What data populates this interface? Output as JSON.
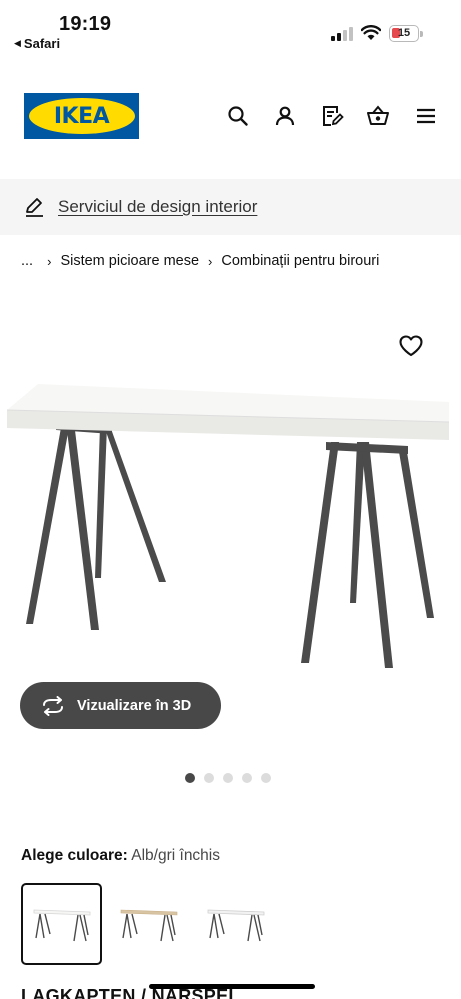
{
  "status_bar": {
    "time": "19:19",
    "back_label": "Safari",
    "battery": "15"
  },
  "header": {
    "logo_text": "IKEA",
    "icons": [
      "search-icon",
      "account-icon",
      "shopping-list-icon",
      "basket-icon",
      "menu-icon"
    ]
  },
  "design_banner": {
    "label": "Serviciul de design interior",
    "icon": "pencil-icon"
  },
  "breadcrumb": {
    "items": [
      "...",
      "Sistem picioare mese",
      "Combinații pentru birouri"
    ],
    "separator": "›"
  },
  "gallery": {
    "view_3d_label": "Vizualizare în 3D",
    "dot_count": 5,
    "active_dot": 1
  },
  "color_select": {
    "label": "Alege culoare:",
    "value": "Alb/gri închis",
    "options": [
      {
        "name": "white-dark-grey",
        "top_color": "#f6f6f4",
        "leg_color": "#4a4a4a",
        "selected": true
      },
      {
        "name": "birch-dark-grey",
        "top_color": "#d8c4a2",
        "leg_color": "#4a4a4a",
        "selected": false
      },
      {
        "name": "white-grey-legs",
        "top_color": "#f2f2f2",
        "leg_color": "#4a4a4a",
        "selected": false
      }
    ]
  },
  "product": {
    "name": "LAGKAPTEN / NÄRSPEL"
  },
  "colors": {
    "ikea_blue": "#0058a3",
    "ikea_yellow": "#ffdb00",
    "button_dark": "#484848",
    "battery_low": "#e5484d"
  }
}
